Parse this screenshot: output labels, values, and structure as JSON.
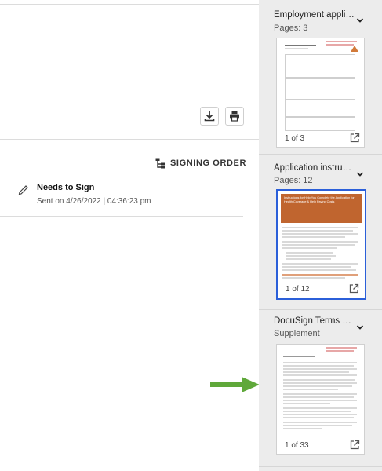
{
  "toolbar": {
    "download_icon": "download-icon",
    "print_icon": "print-icon"
  },
  "signing": {
    "label": "SIGNING ORDER",
    "icon": "signing-order-icon"
  },
  "status": {
    "title": "Needs to Sign",
    "sent": "Sent on 4/26/2022 | 04:36:23 pm",
    "icon": "pencil-icon"
  },
  "documents": [
    {
      "title": "Employment appli…",
      "subtitle": "Pages: 3",
      "page_indicator": "1 of 3"
    },
    {
      "title": "Application instru…",
      "subtitle": "Pages: 12",
      "page_indicator": "1 of 12",
      "thumbnail_heading": "Instructions for Help You Complete the Application for Health Coverage & Help Paying Costs",
      "selected": true
    },
    {
      "title": "DocuSign Terms …",
      "subtitle": "Supplement",
      "page_indicator": "1 of 33"
    }
  ],
  "colors": {
    "accent": "#2b5fd9",
    "sidebar_bg": "#ececec",
    "thumbnail_banner": "#c0652f",
    "arrow": "#5fa83a"
  }
}
